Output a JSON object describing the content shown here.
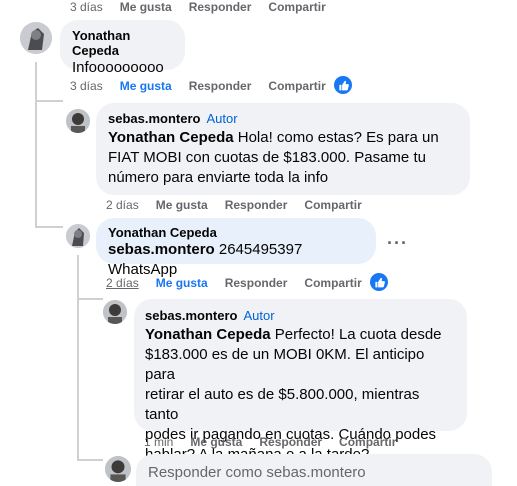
{
  "top_actions": {
    "time": "3 días",
    "like": "Me gusta",
    "reply": "Responder",
    "share": "Compartir"
  },
  "comments": [
    {
      "author": "Yonathan Cepeda",
      "text": "Infooooooooo",
      "time": "3 días",
      "like": "Me gusta",
      "reply": "Responder",
      "share": "Compartir"
    },
    {
      "author": "sebas.montero",
      "badge": "Autor",
      "mention": "Yonathan Cepeda",
      "lines": [
        " Hola! como estas? Es para un",
        "FIAT MOBI con cuotas de $183.000. Pasame tu",
        "número para enviarte toda la info"
      ],
      "time": "2 días",
      "like": "Me gusta",
      "reply": "Responder",
      "share": "Compartir"
    },
    {
      "author": "Yonathan Cepeda",
      "mention": "sebas.montero",
      "text": " 2645495397 WhatsApp",
      "more": "···",
      "time": "2 días",
      "like": "Me gusta",
      "reply": "Responder",
      "share": "Compartir"
    },
    {
      "author": "sebas.montero",
      "badge": "Autor",
      "mention": "Yonathan Cepeda",
      "lines": [
        " Perfecto! La cuota desde",
        "$183.000 es de un MOBI 0KM. El anticipo para",
        "retirar el auto es de $5.800.000, mientras tanto",
        "podes ir pagando en cuotas. Cuándo podes",
        "hablar? A la mañana o a la tarde?"
      ],
      "time": "1 min",
      "like": "Me gusta",
      "reply": "Responder",
      "share": "Compartir"
    }
  ],
  "reply_box": {
    "placeholder": "Responder como sebas.montero"
  },
  "colors": {
    "accent": "#1877f2",
    "author_badge": "#0064d1",
    "bubble": "#f0f2f5",
    "meta": "#65676b"
  }
}
